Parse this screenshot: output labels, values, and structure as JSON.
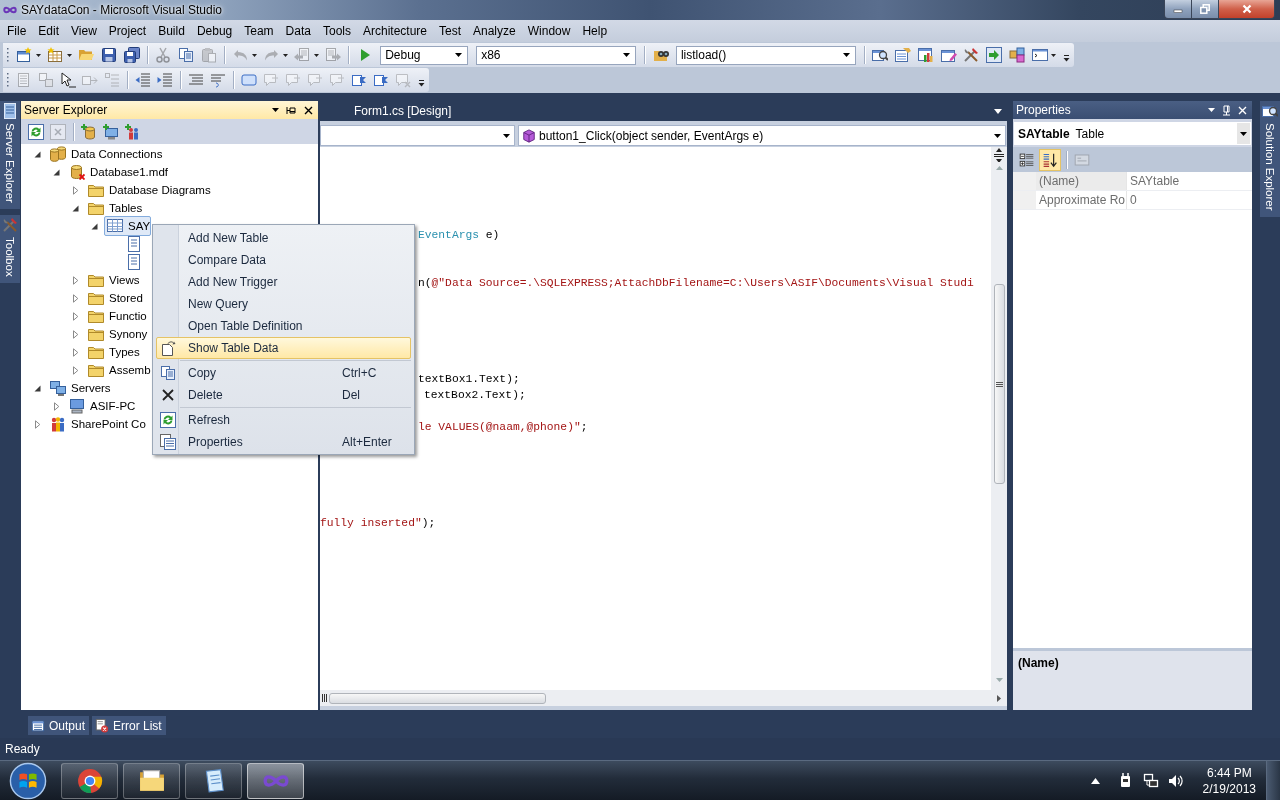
{
  "window": {
    "title": "SAYdataCon - Microsoft Visual Studio"
  },
  "menu_bar": [
    "File",
    "Edit",
    "View",
    "Project",
    "Build",
    "Debug",
    "Team",
    "Data",
    "Tools",
    "Architecture",
    "Test",
    "Analyze",
    "Window",
    "Help"
  ],
  "toolbars": [
    {
      "groups": [
        [
          {
            "kind": "split",
            "disabled": false
          },
          {
            "kind": "split",
            "disabled": false
          },
          {
            "kind": "button",
            "disabled": false
          },
          {
            "kind": "button",
            "disabled": false
          },
          {
            "kind": "button",
            "disabled": false
          }
        ],
        [
          {
            "kind": "button",
            "disabled": true
          },
          {
            "kind": "button",
            "disabled": false
          },
          {
            "kind": "button",
            "disabled": true
          }
        ],
        [
          {
            "kind": "split",
            "disabled": true
          },
          {
            "kind": "split",
            "disabled": true
          },
          {
            "kind": "split",
            "disabled": true
          },
          {
            "kind": "button",
            "disabled": true
          }
        ],
        [
          {
            "kind": "button",
            "disabled": false
          },
          {
            "kind": "combo",
            "value": "Debug"
          },
          {
            "kind": "combo",
            "value": "x86"
          }
        ],
        [
          {
            "kind": "button",
            "disabled": false
          },
          {
            "kind": "combo",
            "value": "listload()"
          }
        ],
        [
          {
            "kind": "button",
            "disabled": false
          },
          {
            "kind": "button",
            "disabled": false
          },
          {
            "kind": "button",
            "disabled": false
          },
          {
            "kind": "button",
            "disabled": false
          },
          {
            "kind": "button",
            "disabled": false
          },
          {
            "kind": "button",
            "disabled": false
          },
          {
            "kind": "button",
            "disabled": false
          },
          {
            "kind": "split",
            "disabled": false
          }
        ]
      ]
    },
    {
      "groups": [
        [
          {
            "kind": "button",
            "disabled": true
          },
          {
            "kind": "button",
            "disabled": true
          },
          {
            "kind": "button",
            "disabled": false
          },
          {
            "kind": "button",
            "disabled": true
          },
          {
            "kind": "button",
            "disabled": true
          }
        ],
        [
          {
            "kind": "button",
            "disabled": false
          },
          {
            "kind": "button",
            "disabled": false
          }
        ],
        [
          {
            "kind": "button",
            "disabled": false
          },
          {
            "kind": "button",
            "disabled": false
          }
        ],
        [
          {
            "kind": "button",
            "disabled": false
          },
          {
            "kind": "button",
            "disabled": true
          },
          {
            "kind": "button",
            "disabled": true
          },
          {
            "kind": "button",
            "disabled": true
          },
          {
            "kind": "button",
            "disabled": true
          },
          {
            "kind": "button",
            "disabled": false
          },
          {
            "kind": "button",
            "disabled": false
          },
          {
            "kind": "button",
            "disabled": true
          }
        ]
      ]
    }
  ],
  "left_dock_tabs": [
    {
      "label": "Server Explorer"
    },
    {
      "label": "Toolbox"
    }
  ],
  "server_explorer": {
    "title": "Server Explorer",
    "active": true,
    "toolbar": {
      "groups": [
        [
          {
            "disabled": false
          },
          {
            "disabled": true
          }
        ],
        [
          {
            "disabled": false
          },
          {
            "disabled": false
          },
          {
            "disabled": false
          }
        ]
      ]
    },
    "tree": [
      {
        "label": "Data Connections",
        "kind": "connections",
        "expanded": true,
        "selected": false,
        "children": [
          {
            "label": "Database1.mdf",
            "kind": "database",
            "connected": false,
            "expanded": true,
            "selected": false,
            "children": [
              {
                "label": "Database Diagrams",
                "kind": "folder",
                "expanded": false,
                "selected": false
              },
              {
                "label": "Tables",
                "kind": "folder",
                "expanded": true,
                "selected": false,
                "children": [
                  {
                    "label": "SAY",
                    "kind": "table",
                    "expanded": true,
                    "selected": true,
                    "children": [
                      {
                        "kind": "column",
                        "selected": false
                      },
                      {
                        "kind": "column",
                        "selected": false
                      }
                    ]
                  }
                ]
              },
              {
                "label": "Views",
                "kind": "folder",
                "expanded": false,
                "selected": false
              },
              {
                "label": "Stored",
                "kind": "folder",
                "expanded": false,
                "selected": false
              },
              {
                "label": "Functio",
                "kind": "folder",
                "expanded": false,
                "selected": false
              },
              {
                "label": "Synony",
                "kind": "folder",
                "expanded": false,
                "selected": false
              },
              {
                "label": "Types",
                "kind": "folder",
                "expanded": false,
                "selected": false
              },
              {
                "label": "Assemb",
                "kind": "folder",
                "expanded": false,
                "selected": false
              }
            ]
          }
        ]
      },
      {
        "label": "Servers",
        "kind": "servers",
        "expanded": true,
        "selected": false,
        "children": [
          {
            "label": "ASIF-PC",
            "kind": "server",
            "expanded": false,
            "selected": false
          }
        ]
      },
      {
        "label": "SharePoint Co",
        "kind": "sharepoint",
        "expanded": false,
        "selected": false
      }
    ]
  },
  "editor": {
    "tabs": [
      {
        "label": "Form1.cs [Design]",
        "selected": false
      }
    ],
    "member": "button1_Click(object sender, EventArgs e)",
    "code_lines": [
      {
        "segments": [
          {
            "text": "EventArgs",
            "kind": "type"
          },
          {
            "text": " e)",
            "kind": "plain"
          }
        ]
      },
      {
        "segments": [
          {
            "text": "n(",
            "kind": "plain"
          },
          {
            "text": "@\"Data Source=.\\SQLEXPRESS;AttachDbFilename=C:\\Users\\ASIF\\Documents\\Visual Studi",
            "kind": "string"
          }
        ]
      },
      {
        "segments": [
          {
            "text": "textBox1.Text);",
            "kind": "plain"
          }
        ]
      },
      {
        "segments": [
          {
            "text": "textBox2.Text);",
            "kind": "plain"
          }
        ]
      },
      {
        "segments": [
          {
            "text": "le VALUES(@naam,@phone)\"",
            "kind": "string"
          },
          {
            "text": ";",
            "kind": "plain"
          }
        ]
      },
      {
        "segments": [
          {
            "text": "fully inserted\"",
            "kind": "string"
          },
          {
            "text": ");",
            "kind": "plain"
          }
        ]
      }
    ]
  },
  "context_menu": {
    "items": [
      {
        "kind": "item",
        "label": "Add New Table",
        "selected": false
      },
      {
        "kind": "item",
        "label": "Compare Data",
        "selected": false
      },
      {
        "kind": "item",
        "label": "Add New Trigger",
        "selected": false
      },
      {
        "kind": "item",
        "label": "New Query",
        "selected": false
      },
      {
        "kind": "item",
        "label": "Open Table Definition",
        "selected": false
      },
      {
        "kind": "item",
        "label": "Show Table Data",
        "selected": true
      },
      {
        "kind": "separator"
      },
      {
        "kind": "item",
        "label": "Copy",
        "shortcut": "Ctrl+C",
        "selected": false
      },
      {
        "kind": "item",
        "label": "Delete",
        "shortcut": "Del",
        "selected": false
      },
      {
        "kind": "separator"
      },
      {
        "kind": "item",
        "label": "Refresh",
        "selected": false
      },
      {
        "kind": "item",
        "label": "Properties",
        "shortcut": "Alt+Enter",
        "selected": false
      }
    ]
  },
  "properties": {
    "title": "Properties",
    "active": false,
    "object_name": "SAYtable",
    "object_type": "Table",
    "toolbar": {
      "groups": [
        [
          {
            "selected": false
          },
          {
            "selected": true
          }
        ],
        [
          {
            "disabled": true
          }
        ]
      ]
    },
    "rows": [
      {
        "name": "(Name)",
        "value": "SAYtable",
        "read_only": true,
        "selected": true
      },
      {
        "name": "Approximate Ro",
        "value": "0",
        "read_only": true,
        "selected": false
      }
    ],
    "description_title": "(Name)"
  },
  "right_dock_tabs": [
    {
      "label": "Solution Explorer"
    }
  ],
  "bottom_tabs": [
    {
      "label": "Output"
    },
    {
      "label": "Error List"
    }
  ],
  "status_bar": {
    "text": "Ready"
  },
  "taskbar": {
    "apps": [
      {
        "selected": false
      },
      {
        "selected": false
      },
      {
        "selected": false
      },
      {
        "selected": true
      }
    ],
    "time": "6:44 PM",
    "date": "2/19/2013"
  }
}
